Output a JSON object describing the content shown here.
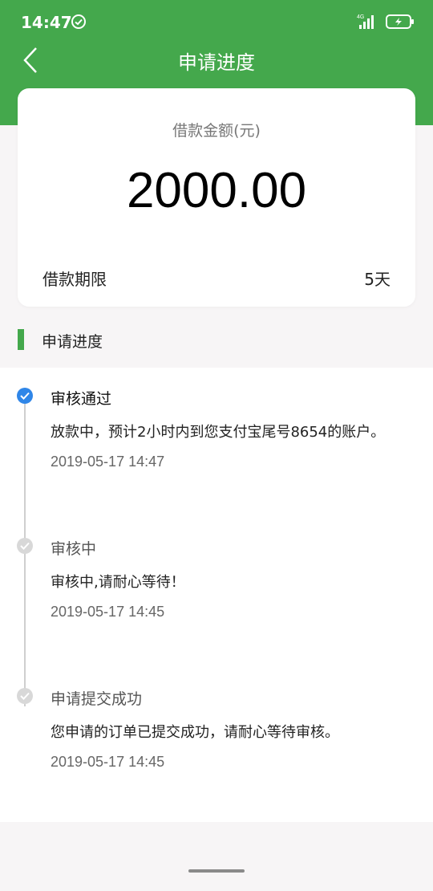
{
  "status_bar": {
    "time": "14:47",
    "network": "4G",
    "icons": [
      "check-circle-icon",
      "signal-icon",
      "battery-charging-icon"
    ]
  },
  "header": {
    "title": "申请进度",
    "color": "#44a84c"
  },
  "card": {
    "amount_label": "借款金额(元)",
    "amount_value": "2000.00",
    "term_label": "借款期限",
    "term_value": "5天"
  },
  "section": {
    "title": "申请进度"
  },
  "timeline": {
    "items": [
      {
        "title": "审核通过",
        "desc": "放款中，预计2小时内到您支付宝尾号8654的账户。",
        "time": "2019-05-17 14:47",
        "status": "done"
      },
      {
        "title": "审核中",
        "desc": "审核中,请耐心等待！",
        "time": "2019-05-17 14:45",
        "status": "inactive"
      },
      {
        "title": "申请提交成功",
        "desc": "您申请的订单已提交成功，请耐心等待审核。",
        "time": "2019-05-17 14:45",
        "status": "inactive"
      }
    ]
  },
  "colors": {
    "accent": "#44a84c",
    "active_dot": "#2f86e8",
    "inactive_dot": "#d8d8d8"
  }
}
